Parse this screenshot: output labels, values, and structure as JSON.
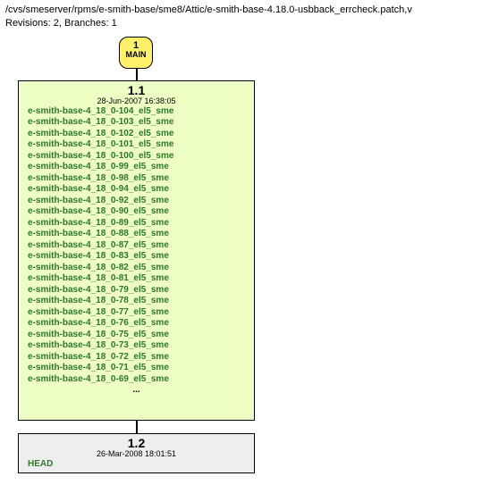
{
  "header": {
    "path": "/cvs/smeserver/rpms/e-smith-base/sme8/Attic/e-smith-base-4.18.0-usbback_errcheck.patch,v",
    "meta": "Revisions: 2, Branches: 1"
  },
  "branch": {
    "number": "1",
    "label": "MAIN"
  },
  "rev11": {
    "rev": "1.1",
    "date": "28-Jun-2007 16:38:05"
  },
  "rev12": {
    "rev": "1.2",
    "date": "26-Mar-2008 18:01:51",
    "head": "HEAD"
  },
  "tags": [
    "e-smith-base-4_18_0-104_el5_sme",
    "e-smith-base-4_18_0-103_el5_sme",
    "e-smith-base-4_18_0-102_el5_sme",
    "e-smith-base-4_18_0-101_el5_sme",
    "e-smith-base-4_18_0-100_el5_sme",
    "e-smith-base-4_18_0-99_el5_sme",
    "e-smith-base-4_18_0-98_el5_sme",
    "e-smith-base-4_18_0-94_el5_sme",
    "e-smith-base-4_18_0-92_el5_sme",
    "e-smith-base-4_18_0-90_el5_sme",
    "e-smith-base-4_18_0-89_el5_sme",
    "e-smith-base-4_18_0-88_el5_sme",
    "e-smith-base-4_18_0-87_el5_sme",
    "e-smith-base-4_18_0-83_el5_sme",
    "e-smith-base-4_18_0-82_el5_sme",
    "e-smith-base-4_18_0-81_el5_sme",
    "e-smith-base-4_18_0-79_el5_sme",
    "e-smith-base-4_18_0-78_el5_sme",
    "e-smith-base-4_18_0-77_el5_sme",
    "e-smith-base-4_18_0-76_el5_sme",
    "e-smith-base-4_18_0-75_el5_sme",
    "e-smith-base-4_18_0-73_el5_sme",
    "e-smith-base-4_18_0-72_el5_sme",
    "e-smith-base-4_18_0-71_el5_sme",
    "e-smith-base-4_18_0-69_el5_sme"
  ],
  "tags_more": "..."
}
